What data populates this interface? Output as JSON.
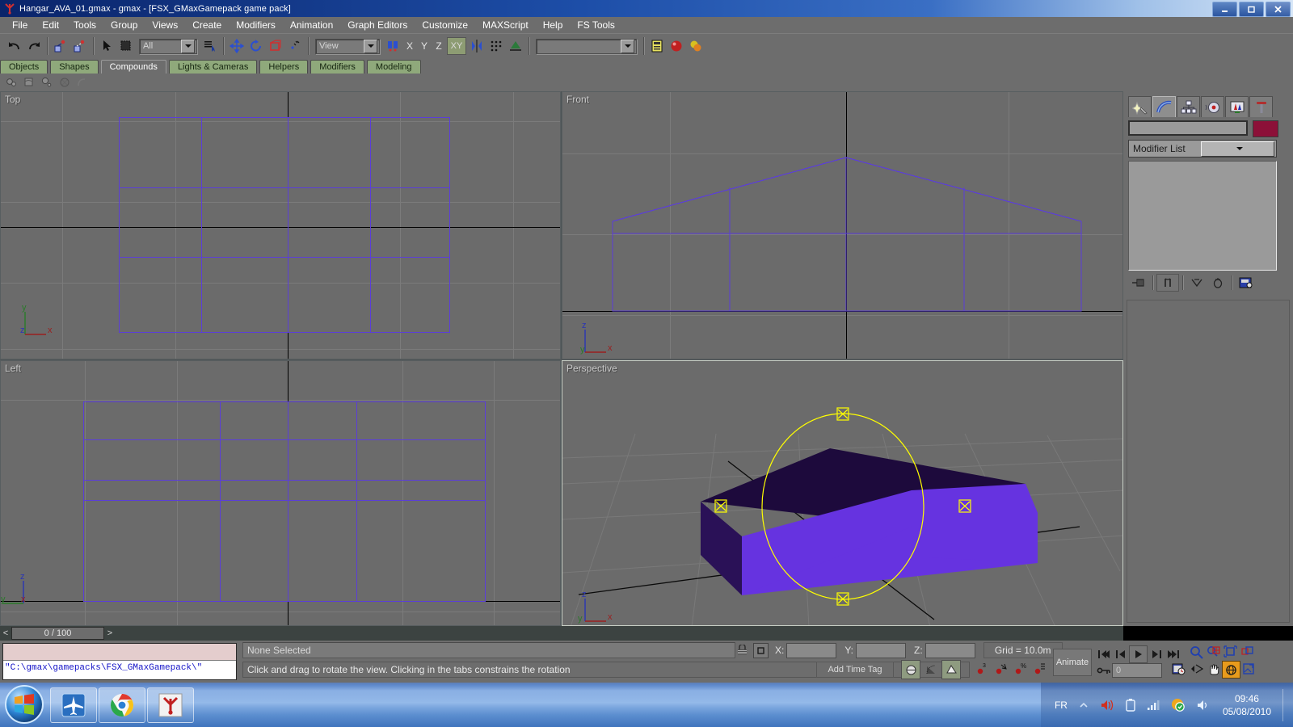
{
  "window": {
    "title": "Hangar_AVA_01.gmax - gmax - [FSX_GMaxGamepack game pack]",
    "icon": "gmax-icon",
    "minimize": "–",
    "maximize": "❐",
    "close": "✕"
  },
  "menu": {
    "items": [
      "File",
      "Edit",
      "Tools",
      "Group",
      "Views",
      "Create",
      "Modifiers",
      "Animation",
      "Graph Editors",
      "Customize",
      "MAXScript",
      "Help",
      "FS Tools"
    ]
  },
  "main_toolbar": {
    "undo": "undo-icon",
    "redo": "redo-icon",
    "select_link": "select-and-link-icon",
    "unlink": "unlink-selection-icon",
    "select_object": "select-object-arrow-icon",
    "select_region": "select-region-icon",
    "selection_filter_value": "All",
    "select_by_name": "select-by-name-icon",
    "select_move": "select-and-move-icon",
    "select_rotate": "select-and-rotate-icon",
    "select_scale": "select-and-scale-icon",
    "ref_coord_value": "View",
    "use_pivot": "use-pivot-point-center-icon",
    "axis_x": "X",
    "axis_y": "Y",
    "axis_z": "Z",
    "axis_xy": "XY",
    "mirror": "mirror-icon",
    "array": "array-icon",
    "align": "align-icon",
    "named_sets_value": "",
    "layer_manager": "layer-manager-icon",
    "material_editor": "material-editor-icon",
    "render_scene": "render-scene-icon"
  },
  "tab_panel": {
    "tabs": [
      "Objects",
      "Shapes",
      "Compounds",
      "Lights & Cameras",
      "Helpers",
      "Modifiers",
      "Modeling"
    ],
    "selected": "Compounds",
    "tools": [
      "morph-icon",
      "conform-icon",
      "scatter-icon",
      "connect-icon",
      "shapemerge-icon"
    ]
  },
  "viewports": [
    {
      "name": "Top",
      "label": "Top",
      "active": false,
      "axes": [
        "y",
        "z",
        "x"
      ]
    },
    {
      "name": "Front",
      "label": "Front",
      "active": false,
      "axes": [
        "z",
        "y",
        "x"
      ]
    },
    {
      "name": "Left",
      "label": "Left",
      "active": false,
      "axes": [
        "z",
        "y",
        "x"
      ]
    },
    {
      "name": "Perspective",
      "label": "Perspective",
      "active": true,
      "axes": [
        "z",
        "y",
        "x"
      ]
    }
  ],
  "command_panel": {
    "tabs": [
      "create-tab-icon",
      "modify-tab-icon",
      "hierarchy-tab-icon",
      "motion-tab-icon",
      "display-tab-icon",
      "utilities-tab-icon"
    ],
    "selected_tab_index": 1,
    "object_name": "",
    "object_color": "#8c1038",
    "modifier_list_label": "Modifier List",
    "stack_buttons": [
      "pin-stack-icon",
      "show-end-result-icon",
      "make-unique-icon",
      "remove-modifier-icon",
      "configure-sets-icon"
    ]
  },
  "time_slider": {
    "prev": "<",
    "value": "0 / 100",
    "next": ">"
  },
  "listener": {
    "text": "\"C:\\gmax\\gamepacks\\FSX_GMaxGamepack\\\""
  },
  "status": {
    "selection": "None Selected",
    "prompt": "Click and drag to rotate the view.  Clicking in the tabs constrains the rotation",
    "lock_icon": "selection-lock-icon",
    "abs_rel_icon": "absolute-relative-toggle-icon",
    "x_label": "X:",
    "x_value": "",
    "y_label": "Y:",
    "y_value": "",
    "z_label": "Z:",
    "z_value": "",
    "grid": "Grid = 10.0m",
    "add_time_tag": "Add Time Tag",
    "animate_label": "Animate",
    "key_value": "0"
  },
  "anim_controls": {
    "buttons": [
      "go-to-start-icon",
      "previous-frame-icon",
      "play-animation-icon",
      "next-frame-icon",
      "go-to-end-icon"
    ],
    "key_mode": "key-mode-toggle-icon",
    "time_config": "time-configuration-icon"
  },
  "view_controls": {
    "buttons": [
      "zoom-icon",
      "zoom-all-icon",
      "zoom-extents-icon",
      "zoom-extents-all-icon",
      "field-of-view-icon",
      "pan-icon",
      "arc-rotate-icon",
      "min-max-toggle-icon"
    ]
  },
  "snap_toggles": [
    "snap-toggle-icon",
    "angle-snap-icon",
    "percent-snap-icon",
    "spinner-snap-icon"
  ],
  "render_toggles": [
    "select-object-shade-icon",
    "select-window-icon",
    "crossing-icon"
  ],
  "taskbar": {
    "start": "windows-start-orb",
    "items": [
      "flight-simulator-icon",
      "google-chrome-icon",
      "gmax-icon"
    ],
    "tray": {
      "language": "FR",
      "expand": "show-hidden-icons-icon",
      "icons": [
        "volume-red-icon",
        "battery-icon",
        "network-signal-icon",
        "security-shield-icon",
        "speaker-icon"
      ],
      "time": "09:46",
      "date": "05/08/2010"
    }
  },
  "colors": {
    "wireframe": "#5b3ed8",
    "selection": "#ffff00",
    "object_light": "#6633e0",
    "object_dark": "#1d0a3c",
    "ui_gray": "#6d6d6d",
    "viewport_bg": "#6b6b6b"
  }
}
